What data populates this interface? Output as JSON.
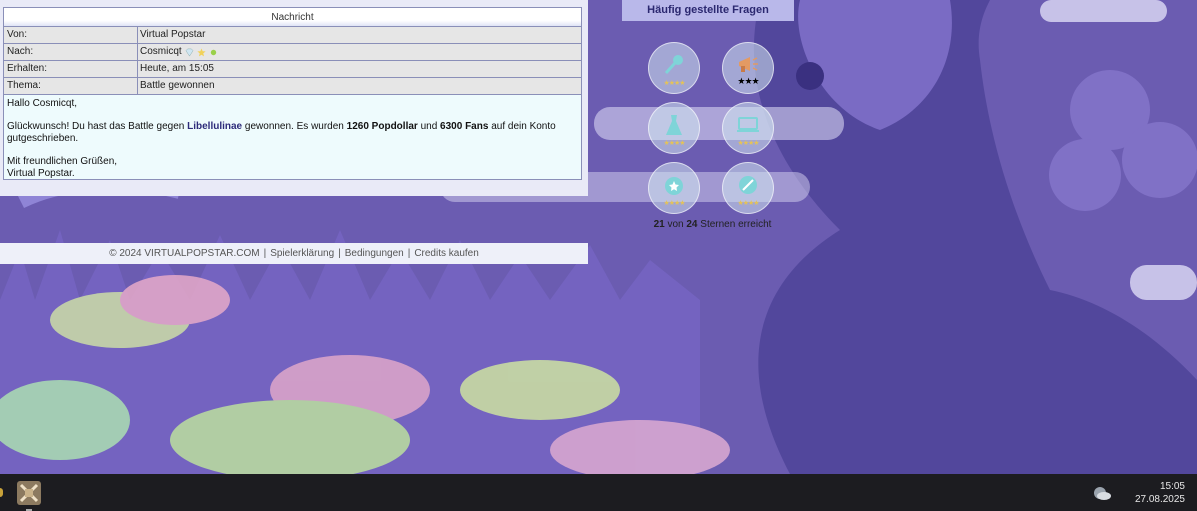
{
  "message": {
    "header": "Nachricht",
    "rows": [
      {
        "key": "Von:",
        "value": "Virtual Popstar"
      },
      {
        "key": "Nach:",
        "value": "Cosmicqt"
      },
      {
        "key": "Erhalten:",
        "value": "Heute, am 15:05"
      },
      {
        "key": "Thema:",
        "value": "Battle gewonnen"
      }
    ],
    "body": {
      "greeting": "Hallo Cosmicqt,",
      "line_pre": "Glückwunsch! Du hast das Battle gegen",
      "opponent": "Libellulinae",
      "line_mid1": "gewonnen. Es wurden",
      "money": "1260 Popdollar",
      "line_mid2": "und",
      "fans": "6300 Fans",
      "line_post": "auf dein Konto gutgeschrieben.",
      "closing1": "Mit freundlichen Grüßen,",
      "closing2": "Virtual Popstar."
    }
  },
  "footer": {
    "copyright": "© 2024 VIRTUALPOPSTAR.COM",
    "sep": "|",
    "links": [
      "Spielerklärung",
      "Bedingungen",
      "Credits kaufen"
    ]
  },
  "faq": {
    "label": "Häufig gestellte Fragen"
  },
  "achievements": {
    "items": [
      {
        "icon": "microphone-icon",
        "stars": "★★★★"
      },
      {
        "icon": "megaphone-icon",
        "stars": "★★★"
      },
      {
        "icon": "dress-icon",
        "stars": "★★★★"
      },
      {
        "icon": "laptop-icon",
        "stars": "★★★★"
      },
      {
        "icon": "medal-icon",
        "stars": "★★★★"
      },
      {
        "icon": "compass-icon",
        "stars": "★★★★"
      }
    ],
    "earned": "21",
    "of": "von",
    "total": "24",
    "suffix": "Sternen erreicht"
  },
  "taskbar": {
    "time": "15:05",
    "date": "27.08.2025"
  },
  "colors": {
    "accent": "#2b2870",
    "panel": "#e9eaf7",
    "body_bg": "#eefbfd",
    "taskbar": "#1c1c20"
  }
}
